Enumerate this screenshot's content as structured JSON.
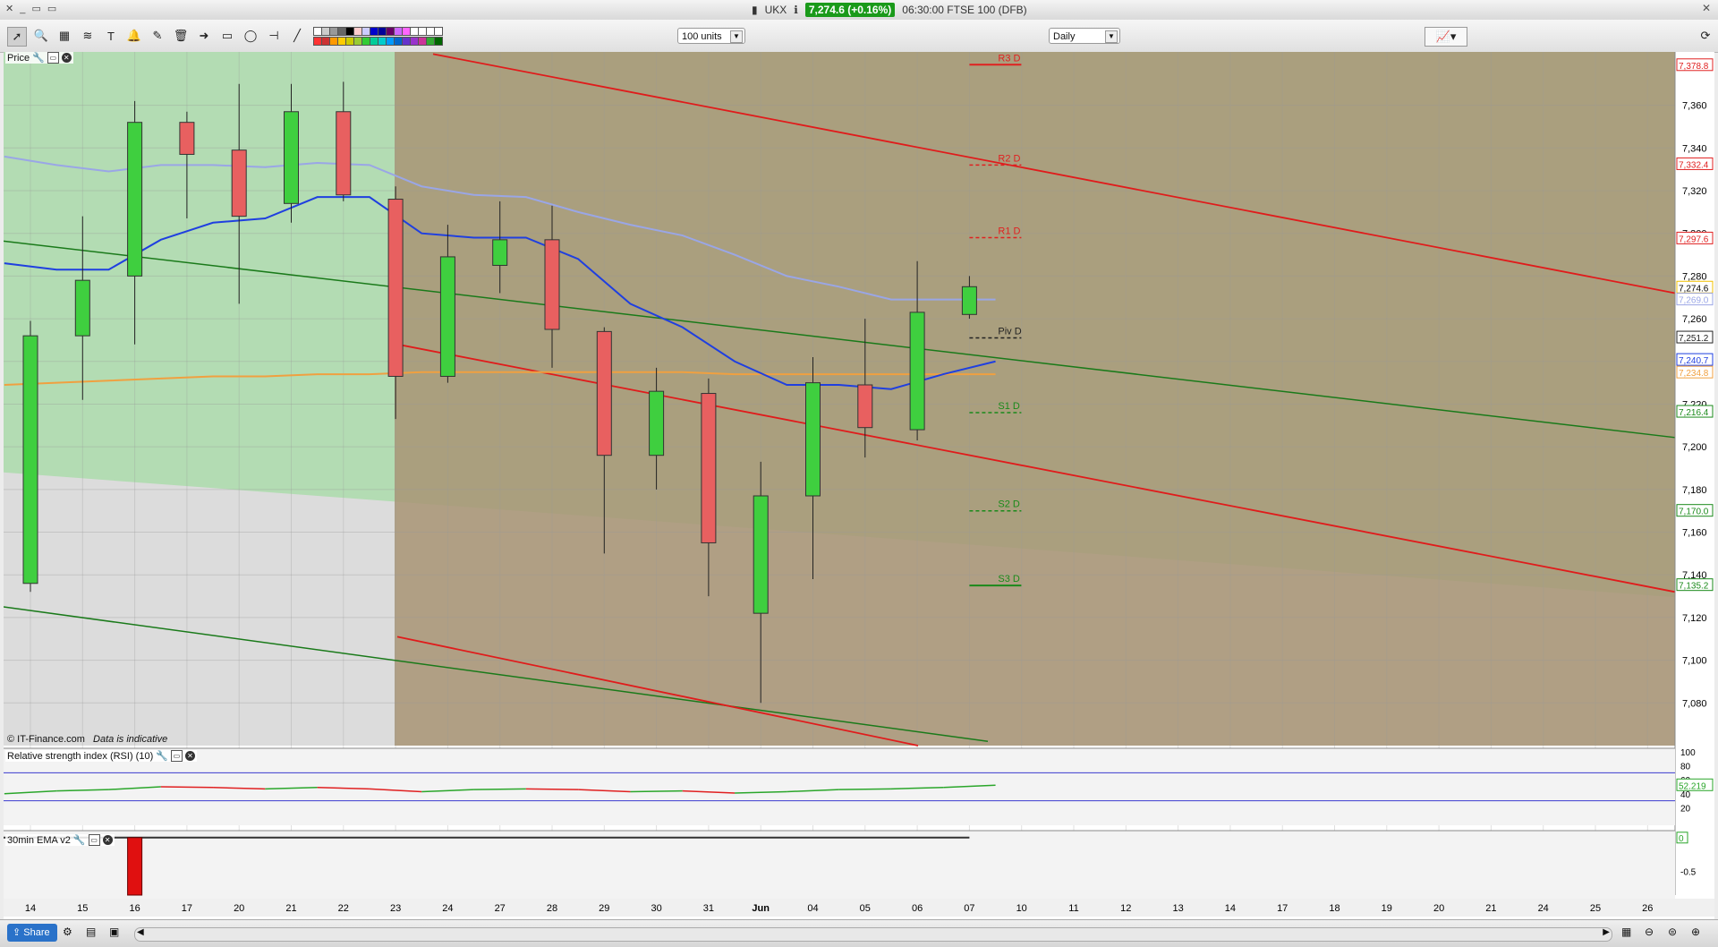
{
  "window": {
    "symbol": "UKX",
    "last_price_badge": "7,274.6 (+0.16%)",
    "time_instrument": "06:30:00 FTSE 100 (DFB)"
  },
  "toolbar": {
    "units_value": "100 units",
    "period_value": "Daily"
  },
  "panels": {
    "price_label": "Price",
    "rsi_label": "Relative strength index (RSI) (10)",
    "ema_label": "30min EMA v2",
    "copyright": "© IT-Finance.com",
    "indicative": "Data is indicative"
  },
  "bottom": {
    "share_label": "Share"
  },
  "colors": {
    "up": "#3fcf3f",
    "down": "#e86060",
    "ma_fast": "#1f3fe0",
    "ma_slow": "#9aa6e6",
    "ma_long": "#f0a040",
    "pivot_resistance": "#e02020",
    "pivot_support": "#1a8a1a",
    "channel_red": "#e01b1b",
    "channel_green": "#1a7a1a"
  },
  "chart_data": [
    {
      "type": "candlestick",
      "title": "Price",
      "x_dates": [
        "14",
        "15",
        "16",
        "17",
        "20",
        "21",
        "22",
        "23",
        "24",
        "27",
        "28",
        "29",
        "30",
        "31",
        "Jun",
        "04",
        "05",
        "06",
        "07"
      ],
      "x_future": [
        "10",
        "11",
        "12",
        "13",
        "14",
        "17",
        "18",
        "19",
        "20",
        "21",
        "24",
        "25",
        "26"
      ],
      "y_ticks": [
        "7,080",
        "7,100",
        "7,120",
        "7,140",
        "7,160",
        "7,180",
        "7,200",
        "7,220",
        "7,240",
        "7,260",
        "7,280",
        "7,300",
        "7,320",
        "7,340",
        "7,360"
      ],
      "y_tick_values": [
        7080,
        7100,
        7120,
        7140,
        7160,
        7180,
        7200,
        7220,
        7240,
        7260,
        7280,
        7300,
        7320,
        7340,
        7360
      ],
      "ylim": [
        7060,
        7385
      ],
      "candles": [
        {
          "o": 7136,
          "h": 7259,
          "l": 7132,
          "c": 7252
        },
        {
          "o": 7252,
          "h": 7308,
          "l": 7222,
          "c": 7278
        },
        {
          "o": 7280,
          "h": 7362,
          "l": 7248,
          "c": 7352
        },
        {
          "o": 7352,
          "h": 7357,
          "l": 7307,
          "c": 7337
        },
        {
          "o": 7339,
          "h": 7370,
          "l": 7267,
          "c": 7308
        },
        {
          "o": 7314,
          "h": 7370,
          "l": 7305,
          "c": 7357
        },
        {
          "o": 7357,
          "h": 7371,
          "l": 7315,
          "c": 7318
        },
        {
          "o": 7316,
          "h": 7322,
          "l": 7213,
          "c": 7233
        },
        {
          "o": 7233,
          "h": 7304,
          "l": 7230,
          "c": 7289
        },
        {
          "o": 7285,
          "h": 7315,
          "l": 7272,
          "c": 7297
        },
        {
          "o": 7297,
          "h": 7313,
          "l": 7237,
          "c": 7255
        },
        {
          "o": 7254,
          "h": 7256,
          "l": 7150,
          "c": 7196
        },
        {
          "o": 7196,
          "h": 7237,
          "l": 7180,
          "c": 7226
        },
        {
          "o": 7225,
          "h": 7232,
          "l": 7130,
          "c": 7155
        },
        {
          "o": 7122,
          "h": 7193,
          "l": 7080,
          "c": 7177
        },
        {
          "o": 7177,
          "h": 7242,
          "l": 7138,
          "c": 7230
        },
        {
          "o": 7229,
          "h": 7260,
          "l": 7195,
          "c": 7209
        },
        {
          "o": 7208,
          "h": 7287,
          "l": 7203,
          "c": 7263
        },
        {
          "o": 7262,
          "h": 7280,
          "l": 7260,
          "c": 7275
        }
      ],
      "ma_fast": [
        7286,
        7283,
        7283,
        7297,
        7305,
        7307,
        7317,
        7317,
        7300,
        7298,
        7298,
        7288,
        7267,
        7256,
        7240,
        7229,
        7229,
        7227,
        7234,
        7240
      ],
      "ma_slow": [
        7336,
        7332,
        7329,
        7332,
        7332,
        7331,
        7333,
        7332,
        7322,
        7318,
        7317,
        7310,
        7304,
        7299,
        7290,
        7280,
        7275,
        7269,
        7269,
        7269
      ],
      "ma_long": [
        7229,
        7230,
        7231,
        7232,
        7233,
        7233,
        7234,
        7234,
        7235,
        7235,
        7235,
        7235,
        7235,
        7235,
        7234,
        7234,
        7234,
        7234,
        7234,
        7234
      ],
      "pivots": [
        {
          "label": "R3 D",
          "value": 7379
        },
        {
          "label": "R2 D",
          "value": 7332
        },
        {
          "label": "R1 D",
          "value": 7298
        },
        {
          "label": "Piv D",
          "value": 7251
        },
        {
          "label": "S1 D",
          "value": 7216
        },
        {
          "label": "S2 D",
          "value": 7170
        },
        {
          "label": "S3 D",
          "value": 7135
        }
      ],
      "right_labels": [
        {
          "text": "7,378.8",
          "value": 7378.8,
          "color": "#e02020"
        },
        {
          "text": "7,332.4",
          "value": 7332.4,
          "color": "#e02020"
        },
        {
          "text": "7,297.6",
          "value": 7297.6,
          "color": "#e02020"
        },
        {
          "text": "7,274.6",
          "value": 7274.6,
          "color": "#f0c000"
        },
        {
          "text": "7,269.0",
          "value": 7269.0,
          "color": "#9aa6e6"
        },
        {
          "text": "7,251.2",
          "value": 7251.2,
          "color": "#222222"
        },
        {
          "text": "7,240.7",
          "value": 7240.7,
          "color": "#1f3fe0"
        },
        {
          "text": "7,234.8",
          "value": 7234.8,
          "color": "#f0a040"
        },
        {
          "text": "7,216.4",
          "value": 7216.4,
          "color": "#1a8a1a"
        },
        {
          "text": "7,170.0",
          "value": 7170.0,
          "color": "#1a8a1a"
        },
        {
          "text": "7,135.2",
          "value": 7135.2,
          "color": "#1a8a1a"
        }
      ]
    },
    {
      "type": "line",
      "title": "Relative strength index (RSI) (10)",
      "y_ticks": [
        "100",
        "80",
        "60",
        "40",
        "20"
      ],
      "y_tick_values": [
        100,
        80,
        60,
        40,
        20
      ],
      "ylim": [
        0,
        100
      ],
      "bands": [
        70,
        30
      ],
      "values": [
        40,
        44,
        46,
        50,
        49,
        47,
        49,
        47,
        43,
        46,
        47,
        46,
        43,
        44,
        41,
        43,
        46,
        47,
        49,
        52.2
      ],
      "last_label": "52.219"
    },
    {
      "type": "bar",
      "title": "30min EMA v2",
      "y_ticks": [
        "0",
        "-0.5"
      ],
      "y_tick_values": [
        0,
        -0.5
      ],
      "ylim": [
        -0.85,
        0.05
      ],
      "values": [
        0,
        0,
        -0.85,
        0,
        0,
        0,
        0,
        0,
        0,
        0,
        0,
        0,
        0,
        0,
        0,
        0,
        0,
        0,
        0
      ],
      "last_label": "0"
    }
  ]
}
